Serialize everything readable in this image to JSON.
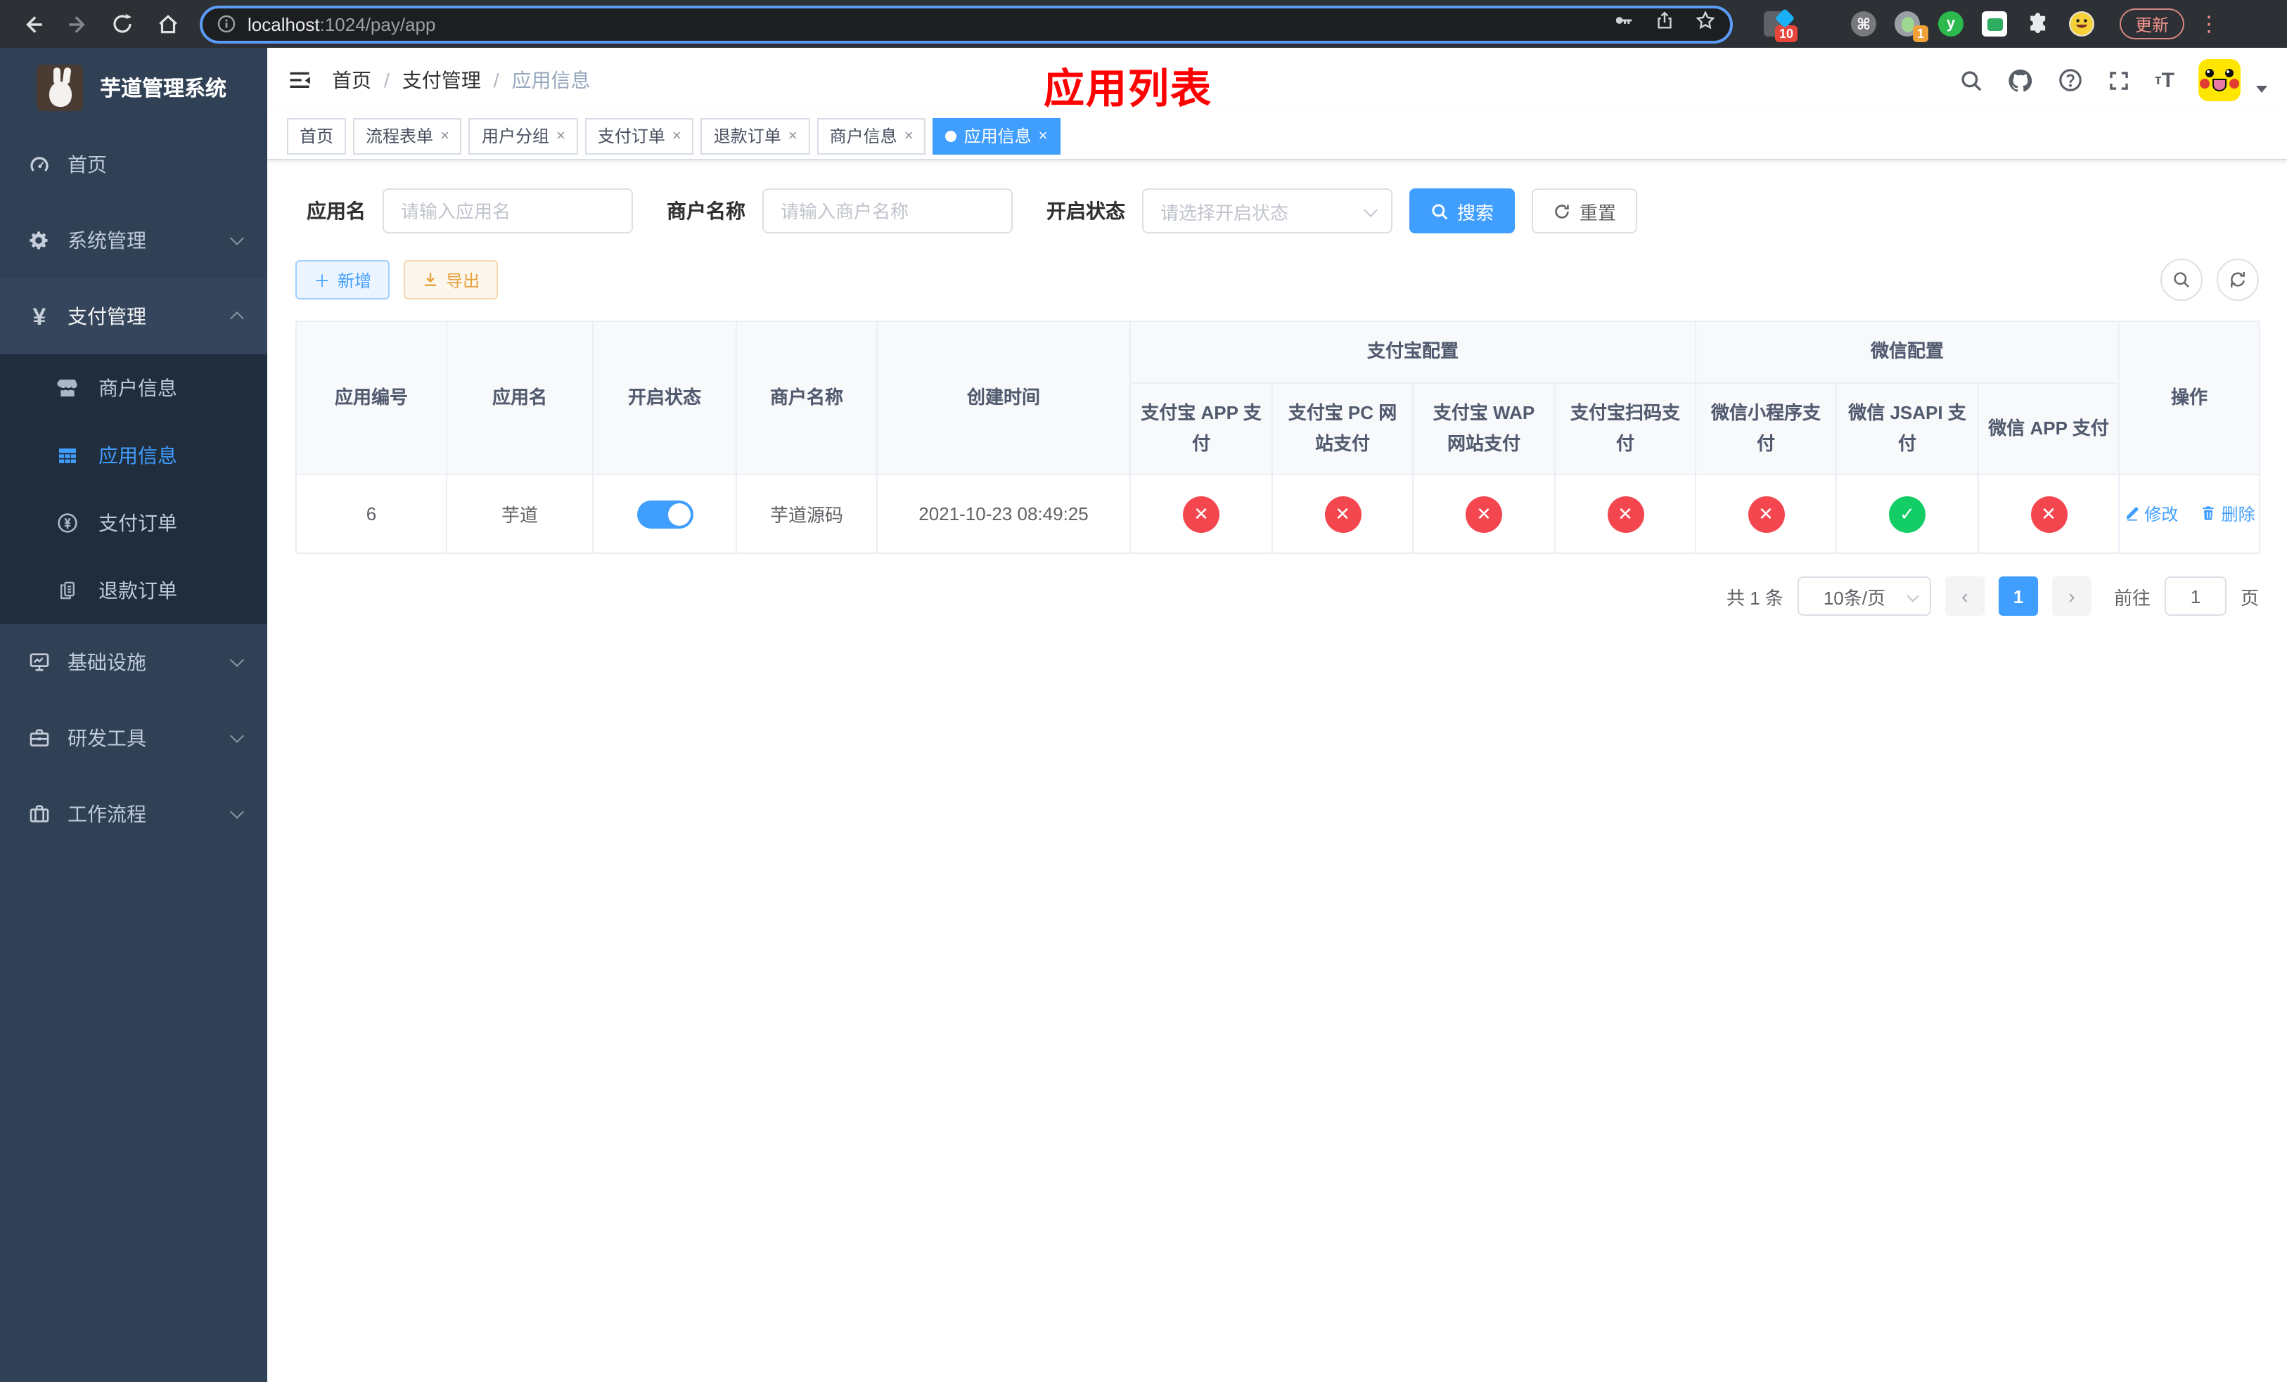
{
  "browser": {
    "url_host": "localhost",
    "url_path": ":1024/pay/app",
    "update_label": "更新",
    "ext_badge_pinned": "10",
    "ext_badge_avatar": "1",
    "ext_y_letter": "y"
  },
  "sidebar": {
    "title": "芋道管理系统",
    "items": [
      {
        "key": "home",
        "label": "首页",
        "icon": "dashboard-icon",
        "type": "top"
      },
      {
        "key": "system",
        "label": "系统管理",
        "icon": "gear-icon",
        "type": "top",
        "chevron": "down"
      },
      {
        "key": "payment",
        "label": "支付管理",
        "icon": "yen-icon",
        "type": "top",
        "chevron": "up",
        "open": true
      },
      {
        "key": "merchant-info",
        "label": "商户信息",
        "icon": "shop-icon",
        "type": "sub"
      },
      {
        "key": "app-info",
        "label": "应用信息",
        "icon": "grid-icon",
        "type": "sub",
        "active": true
      },
      {
        "key": "pay-order",
        "label": "支付订单",
        "icon": "yen-circle-icon",
        "type": "sub"
      },
      {
        "key": "refund-order",
        "label": "退款订单",
        "icon": "docs-icon",
        "type": "sub"
      },
      {
        "key": "infrastructure",
        "label": "基础设施",
        "icon": "monitor-icon",
        "type": "top",
        "chevron": "down"
      },
      {
        "key": "dev-tools",
        "label": "研发工具",
        "icon": "briefcase-icon",
        "type": "top",
        "chevron": "down"
      },
      {
        "key": "workflow",
        "label": "工作流程",
        "icon": "suitcase-icon",
        "type": "top",
        "chevron": "down"
      }
    ]
  },
  "navbar": {
    "breadcrumb": [
      "首页",
      "支付管理",
      "应用信息"
    ],
    "breadcrumb_sep": "/",
    "page_title": "应用列表"
  },
  "tabs": [
    {
      "label": "首页",
      "closable": false,
      "active": false
    },
    {
      "label": "流程表单",
      "closable": true,
      "active": false
    },
    {
      "label": "用户分组",
      "closable": true,
      "active": false
    },
    {
      "label": "支付订单",
      "closable": true,
      "active": false
    },
    {
      "label": "退款订单",
      "closable": true,
      "active": false
    },
    {
      "label": "商户信息",
      "closable": true,
      "active": false
    },
    {
      "label": "应用信息",
      "closable": true,
      "active": true
    }
  ],
  "filters": {
    "app_name_label": "应用名",
    "app_name_placeholder": "请输入应用名",
    "merchant_label": "商户名称",
    "merchant_placeholder": "请输入商户名称",
    "status_label": "开启状态",
    "status_placeholder": "请选择开启状态",
    "search_label": "搜索",
    "reset_label": "重置"
  },
  "toolbar": {
    "add_label": "新增",
    "export_label": "导出"
  },
  "table": {
    "headers": {
      "app_id": "应用编号",
      "app_name": "应用名",
      "status": "开启状态",
      "merchant": "商户名称",
      "create_time": "创建时间",
      "alipay_group": "支付宝配置",
      "wechat_group": "微信配置",
      "actions": "操作",
      "alipay_cols": [
        "支付宝 APP 支付",
        "支付宝 PC 网站支付",
        "支付宝 WAP 网站支付",
        "支付宝扫码支付"
      ],
      "wechat_cols": [
        "微信小程序支付",
        "微信 JSAPI 支付",
        "微信 APP 支付"
      ]
    },
    "row": {
      "app_id": "6",
      "app_name": "芋道",
      "status_on": true,
      "merchant": "芋道源码",
      "create_time": "2021-10-23 08:49:25",
      "configs": [
        "disabled",
        "disabled",
        "disabled",
        "disabled",
        "disabled",
        "enabled",
        "disabled"
      ],
      "edit_label": "修改",
      "delete_label": "删除"
    }
  },
  "pagination": {
    "total_label": "共 1 条",
    "page_size": "10条/页",
    "current_page": "1",
    "goto_label": "前往",
    "goto_value": "1",
    "page_suffix": "页"
  },
  "colors": {
    "accent": "#409eff",
    "danger": "#f4464f",
    "success": "#13ce66",
    "title_red": "#ff0000"
  }
}
